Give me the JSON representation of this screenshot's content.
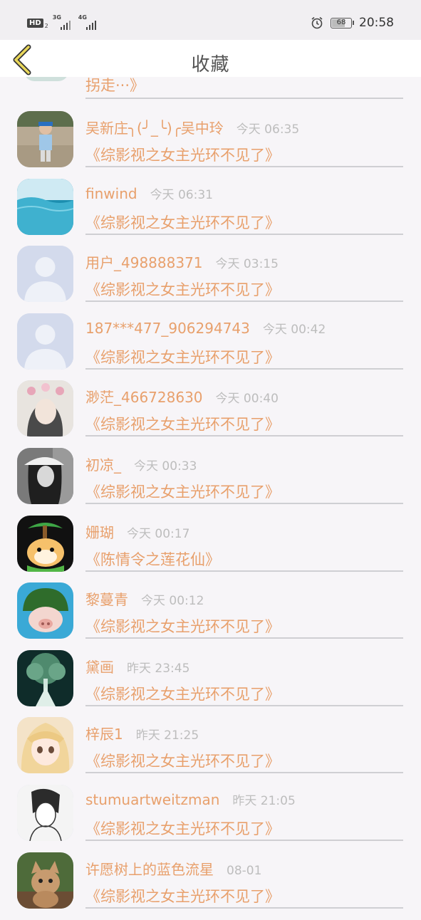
{
  "status_bar": {
    "network_1": "3G",
    "network_2": "4G",
    "battery": "68",
    "battery_level": 0.68,
    "time": "20:58"
  },
  "header": {
    "title": "收藏",
    "back_icon": "chevron-left-icon"
  },
  "partial_item": {
    "book": "拐走···》"
  },
  "items": [
    {
      "name": "吴新庄╮(╯_╰)╭吴中玲",
      "time": "今天 06:35",
      "book": "《综影视之女主光环不见了》",
      "avatar": "photo-child"
    },
    {
      "name": "finwind",
      "time": "今天 06:31",
      "book": "《综影视之女主光环不见了》",
      "avatar": "water"
    },
    {
      "name": "用户_498888371",
      "time": "今天 03:15",
      "book": "《综影视之女主光环不见了》",
      "avatar": "default"
    },
    {
      "name": "187***477_906294743",
      "time": "今天 00:42",
      "book": "《综影视之女主光环不见了》",
      "avatar": "default"
    },
    {
      "name": "渺茫_466728630",
      "time": "今天 00:40",
      "book": "《综影视之女主光环不见了》",
      "avatar": "girl-flowers"
    },
    {
      "name": "初凉_",
      "time": "今天 00:33",
      "book": "《综影视之女主光环不见了》",
      "avatar": "girl-hat"
    },
    {
      "name": "姗瑚",
      "time": "今天 00:17",
      "book": "《陈情令之莲花仙》",
      "avatar": "cartoon-dog"
    },
    {
      "name": "黎蔓青",
      "time": "今天 00:12",
      "book": "《综影视之女主光环不见了》",
      "avatar": "pig-helmet"
    },
    {
      "name": "黛画",
      "time": "昨天 23:45",
      "book": "《综影视之女主光环不见了》",
      "avatar": "forest"
    },
    {
      "name": "梓辰1",
      "time": "昨天 21:25",
      "book": "《综影视之女主光环不见了》",
      "avatar": "anime-girl"
    },
    {
      "name": "stumuartweitzman",
      "time": "昨天 21:05",
      "book": "《综影视之女主光环不见了》",
      "avatar": "sketch"
    },
    {
      "name": "许愿树上的蓝色流星",
      "time": "08-01",
      "book": "《综影视之女主光环不见了》",
      "avatar": "kitten"
    }
  ]
}
